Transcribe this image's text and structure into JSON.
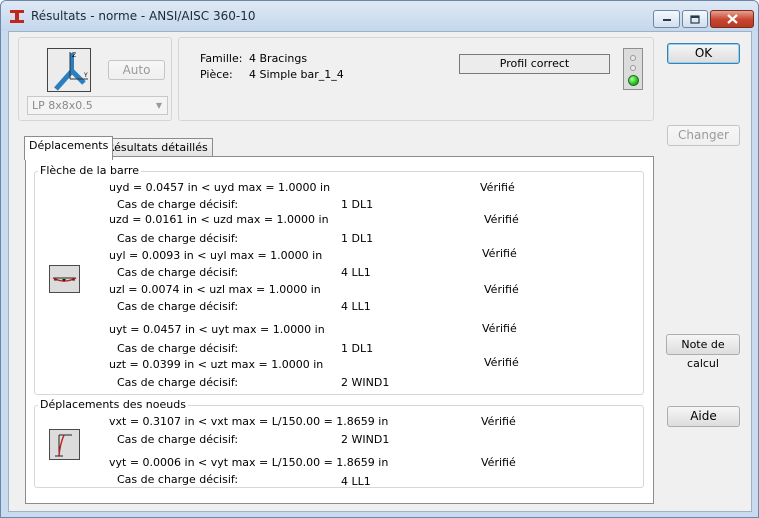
{
  "window": {
    "title": "Résultats - norme - ANSI/AISC 360-10",
    "controls": {
      "minimize": "minimize-icon",
      "maximize": "maximize-icon",
      "close": "close-icon"
    }
  },
  "section": {
    "auto_button": "Auto",
    "profile_value": "LP 8x8x0.5"
  },
  "info": {
    "famille_label": "Famille:",
    "famille_value": "4  Bracings",
    "piece_label": "Pièce:",
    "piece_value": "4  Simple bar_1_4",
    "status_text": "Profil correct",
    "status_color": "#1fc01a"
  },
  "buttons": {
    "ok": "OK",
    "changer": "Changer",
    "note": "Note de calcul",
    "aide": "Aide"
  },
  "tabs": [
    {
      "label": "Déplacements",
      "active": true
    },
    {
      "label": "Résultats détaillés",
      "active": false
    }
  ],
  "fleche": {
    "legend": "Flèche de la barre",
    "rows": [
      {
        "check": "uyd = 0.0457 in  <  uyd max = 1.0000 in",
        "status": "Vérifié",
        "case_label": "Cas de charge décisif:",
        "case": "1 DL1"
      },
      {
        "check": "uzd = 0.0161 in  <  uzd max = 1.0000 in",
        "status": "Vérifié",
        "case_label": "Cas de charge décisif:",
        "case": "1 DL1"
      },
      {
        "check": "uyl = 0.0093 in  <  uyl max = 1.0000 in",
        "status": "Vérifié",
        "case_label": "Cas de charge décisif:",
        "case": "4 LL1"
      },
      {
        "check": "uzl = 0.0074 in  <  uzl max = 1.0000 in",
        "status": "Vérifié",
        "case_label": "Cas de charge décisif:",
        "case": "4 LL1"
      },
      {
        "check": "uyt = 0.0457 in  <  uyt max = 1.0000 in",
        "status": "Vérifié",
        "case_label": "Cas de charge décisif:",
        "case": "1 DL1"
      },
      {
        "check": "uzt = 0.0399 in  <  uzt max = 1.0000 in",
        "status": "Vérifié",
        "case_label": "Cas de charge décisif:",
        "case": "2 WIND1"
      }
    ]
  },
  "noeuds": {
    "legend": "Déplacements des noeuds",
    "rows": [
      {
        "check": "vxt = 0.3107 in  <  vxt max = L/150.00 = 1.8659 in",
        "status": "Vérifié",
        "case_label": "Cas de charge décisif:",
        "case": "2 WIND1"
      },
      {
        "check": "vyt = 0.0006 in  <  vyt max = L/150.00 = 1.8659 in",
        "status": "Vérifié",
        "case_label": "Cas de charge décisif:",
        "case": "4 LL1"
      }
    ]
  }
}
